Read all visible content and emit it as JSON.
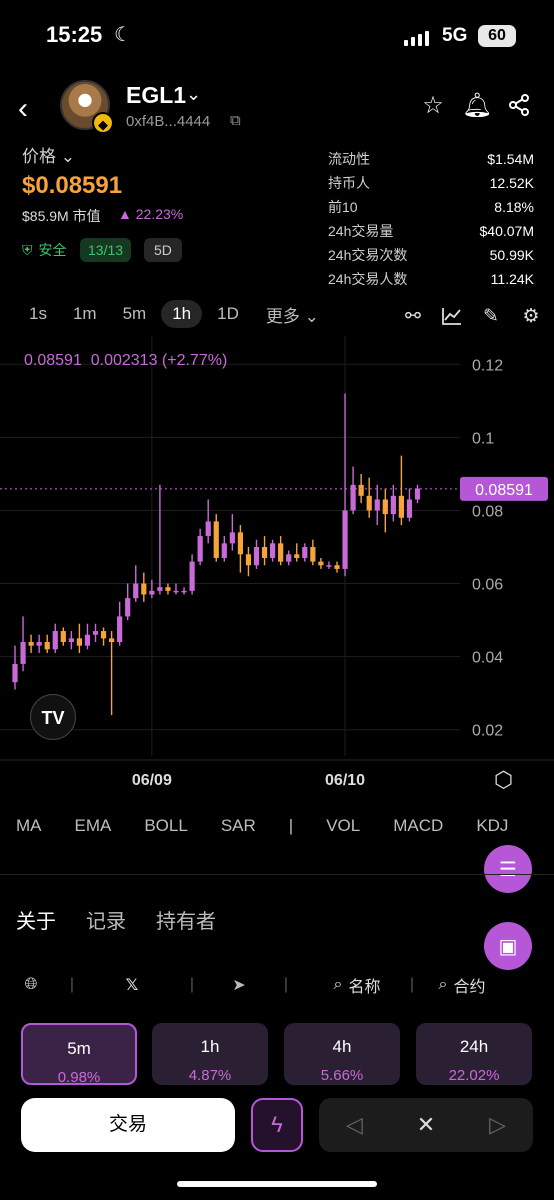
{
  "status": {
    "time": "15:25",
    "network": "5G",
    "battery": "60"
  },
  "token": {
    "name": "EGL1",
    "address": "0xf4B...4444"
  },
  "price": {
    "label": "价格",
    "value": "$0.08591",
    "market_cap": "$85.9M 市值",
    "change": "22.23%",
    "safety_label": "安全",
    "safety_count": "13/13",
    "age": "5D"
  },
  "stats": [
    {
      "k": "流动性",
      "v": "$1.54M"
    },
    {
      "k": "持币人",
      "v": "12.52K"
    },
    {
      "k": "前10",
      "v": "8.18%"
    },
    {
      "k": "24h交易量",
      "v": "$40.07M"
    },
    {
      "k": "24h交易次数",
      "v": "50.99K"
    },
    {
      "k": "24h交易人数",
      "v": "11.24K"
    }
  ],
  "intervals": [
    "1s",
    "1m",
    "5m",
    "1h",
    "1D"
  ],
  "active_interval": "1h",
  "more_label": "更多",
  "indicators": [
    "MA",
    "EMA",
    "BOLL",
    "SAR",
    "|",
    "VOL",
    "MACD",
    "KDJ"
  ],
  "tabs": [
    "关于",
    "记录",
    "持有者"
  ],
  "links": {
    "name": "名称",
    "contract": "合约"
  },
  "changes": [
    {
      "label": "5m",
      "value": "0.98%"
    },
    {
      "label": "1h",
      "value": "4.87%"
    },
    {
      "label": "4h",
      "value": "5.66%"
    },
    {
      "label": "24h",
      "value": "22.02%"
    }
  ],
  "trade_label": "交易",
  "colors": {
    "accent": "#b557d6",
    "price": "#f7a33b",
    "up": "#c86ad8",
    "down": "#f7a33b",
    "safe": "#3ec46d"
  },
  "chart_data": {
    "type": "candlestick",
    "overlay_text": {
      "price": "0.08591",
      "change": "0.002313 (+2.77%)"
    },
    "current_price": "0.08591",
    "ylim": [
      0.015,
      0.125
    ],
    "y_ticks": [
      "0.12",
      "0.1",
      "0.08",
      "0.06",
      "0.04",
      "0.02"
    ],
    "x_ticks": [
      {
        "label": "06/09",
        "index": 17
      },
      {
        "label": "06/10",
        "index": 41
      }
    ],
    "candles": [
      [
        0.033,
        0.038,
        0.031,
        0.043
      ],
      [
        0.038,
        0.044,
        0.036,
        0.051
      ],
      [
        0.044,
        0.043,
        0.041,
        0.046
      ],
      [
        0.043,
        0.044,
        0.041,
        0.046
      ],
      [
        0.044,
        0.042,
        0.041,
        0.046
      ],
      [
        0.042,
        0.047,
        0.041,
        0.049
      ],
      [
        0.047,
        0.044,
        0.043,
        0.048
      ],
      [
        0.044,
        0.045,
        0.042,
        0.047
      ],
      [
        0.045,
        0.043,
        0.041,
        0.049
      ],
      [
        0.043,
        0.046,
        0.042,
        0.049
      ],
      [
        0.046,
        0.047,
        0.044,
        0.049
      ],
      [
        0.047,
        0.045,
        0.043,
        0.048
      ],
      [
        0.045,
        0.044,
        0.024,
        0.047
      ],
      [
        0.044,
        0.051,
        0.043,
        0.055
      ],
      [
        0.051,
        0.056,
        0.05,
        0.06
      ],
      [
        0.056,
        0.06,
        0.055,
        0.065
      ],
      [
        0.06,
        0.057,
        0.055,
        0.063
      ],
      [
        0.057,
        0.058,
        0.056,
        0.061
      ],
      [
        0.058,
        0.059,
        0.057,
        0.087
      ],
      [
        0.059,
        0.058,
        0.057,
        0.06
      ],
      [
        0.058,
        0.058,
        0.057,
        0.06
      ],
      [
        0.058,
        0.058,
        0.057,
        0.059
      ],
      [
        0.058,
        0.066,
        0.057,
        0.068
      ],
      [
        0.066,
        0.073,
        0.065,
        0.075
      ],
      [
        0.073,
        0.077,
        0.071,
        0.083
      ],
      [
        0.077,
        0.067,
        0.066,
        0.079
      ],
      [
        0.067,
        0.071,
        0.066,
        0.073
      ],
      [
        0.071,
        0.074,
        0.069,
        0.079
      ],
      [
        0.074,
        0.068,
        0.063,
        0.076
      ],
      [
        0.068,
        0.065,
        0.062,
        0.07
      ],
      [
        0.065,
        0.07,
        0.064,
        0.072
      ],
      [
        0.07,
        0.067,
        0.065,
        0.073
      ],
      [
        0.067,
        0.071,
        0.066,
        0.072
      ],
      [
        0.071,
        0.066,
        0.065,
        0.073
      ],
      [
        0.066,
        0.068,
        0.065,
        0.069
      ],
      [
        0.068,
        0.067,
        0.066,
        0.071
      ],
      [
        0.067,
        0.07,
        0.066,
        0.071
      ],
      [
        0.07,
        0.066,
        0.065,
        0.072
      ],
      [
        0.066,
        0.065,
        0.064,
        0.067
      ],
      [
        0.065,
        0.065,
        0.064,
        0.066
      ],
      [
        0.065,
        0.064,
        0.063,
        0.066
      ],
      [
        0.064,
        0.08,
        0.062,
        0.112
      ],
      [
        0.08,
        0.087,
        0.079,
        0.092
      ],
      [
        0.087,
        0.084,
        0.082,
        0.09
      ],
      [
        0.084,
        0.08,
        0.078,
        0.089
      ],
      [
        0.08,
        0.083,
        0.076,
        0.087
      ],
      [
        0.083,
        0.079,
        0.074,
        0.086
      ],
      [
        0.079,
        0.084,
        0.077,
        0.087
      ],
      [
        0.084,
        0.078,
        0.076,
        0.095
      ],
      [
        0.078,
        0.083,
        0.077,
        0.086
      ],
      [
        0.083,
        0.086,
        0.082,
        0.087
      ]
    ]
  }
}
